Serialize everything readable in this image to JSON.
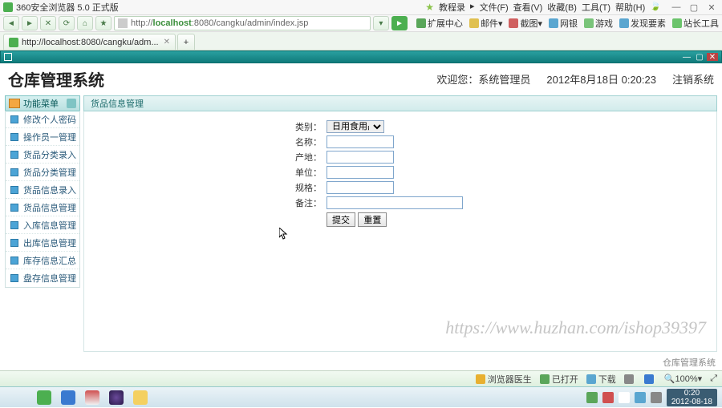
{
  "browser": {
    "title": "360安全浏览器 5.0 正式版",
    "top_menus": [
      "教程录",
      "文件(F)",
      "查看(V)",
      "收藏(B)",
      "工具(T)",
      "帮助(H)"
    ],
    "address_prefix": "http://",
    "address_host": "localhost",
    "address_port_path": ":8080/cangku/admin/index.jsp",
    "tab_label": "http://localhost:8080/cangku/adm...",
    "ext": {
      "ext1": "扩展中心",
      "ext2": "邮件",
      "ext3": "截图",
      "ext4": "网银",
      "ext5": "游戏",
      "ext6": "发现要素",
      "ext7": "站长工具"
    }
  },
  "page": {
    "window_title": "",
    "system_title": "仓库管理系统",
    "welcome_label": "欢迎您：",
    "welcome_user": "系统管理员",
    "datetime": "2012年8月18日  0:20:23",
    "logout_label": "注销系统"
  },
  "sidebar": {
    "panel_title": "功能菜单",
    "panel_sub": "",
    "items": [
      {
        "label": "修改个人密码"
      },
      {
        "label": "操作员一管理"
      },
      {
        "label": "货品分类录入"
      },
      {
        "label": "货品分类管理"
      },
      {
        "label": "货品信息录入"
      },
      {
        "label": "货品信息管理"
      },
      {
        "label": "入库信息管理"
      },
      {
        "label": "出库信息管理"
      },
      {
        "label": "库存信息汇总"
      },
      {
        "label": "盘存信息管理"
      }
    ]
  },
  "content": {
    "panel_title": "货品信息管理",
    "fields": {
      "category_label": "类别：",
      "category_value": "日用食用品",
      "name_label": "名称：",
      "name_value": "",
      "origin_label": "产地：",
      "origin_value": "",
      "unit_label": "单位：",
      "unit_value": "",
      "spec_label": "规格：",
      "spec_value": "",
      "remark_label": "备注：",
      "remark_value": ""
    },
    "buttons": {
      "submit": "提交",
      "reset": "重置"
    }
  },
  "footer_brand": "仓库管理系统",
  "watermark": "https://www.huzhan.com/ishop39397",
  "statusbar": {
    "s1": "浏览器医生",
    "s2": "已打开",
    "s3": "下载",
    "s4": "",
    "s5": "",
    "zoom": "100%"
  },
  "tray": {
    "time": "0:20",
    "date": "2012-08-18"
  }
}
